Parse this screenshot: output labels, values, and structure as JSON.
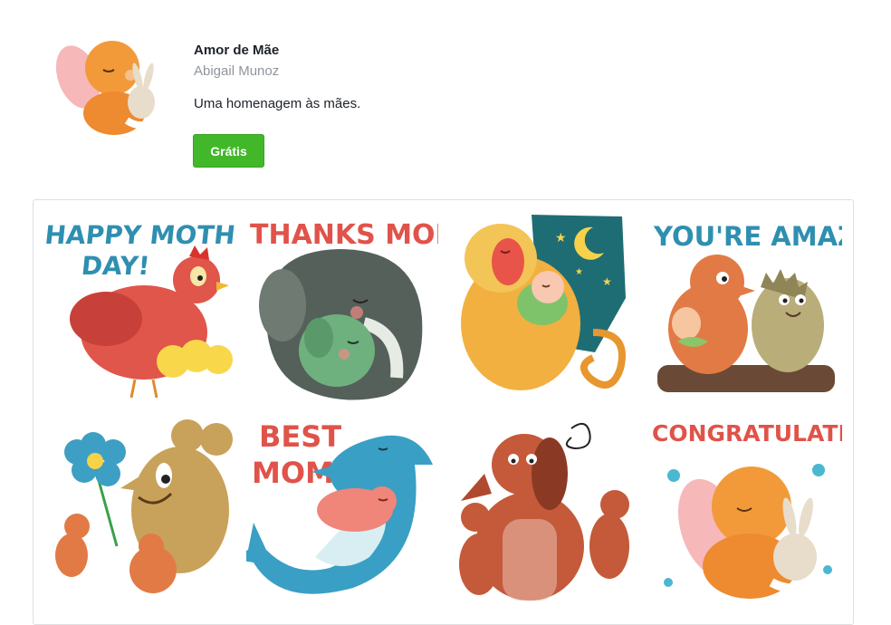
{
  "pack": {
    "title": "Amor de Mãe",
    "author": "Abigail Munoz",
    "description": "Uma homenagem às mães.",
    "price_button": "Grátis",
    "icon": "mother-and-baby-sticker-icon"
  },
  "stickers": [
    {
      "caption": "HAPPY MOTHER'S",
      "caption2": "DAY!",
      "icon": "hen-with-chicks-sticker"
    },
    {
      "caption": "THANKS MOM",
      "icon": "elephant-hug-sticker"
    },
    {
      "caption": "",
      "icon": "monkey-with-baby-sticker"
    },
    {
      "caption": "YOU'RE AMAZING",
      "icon": "bear-and-hedgehog-sticker"
    },
    {
      "caption": "",
      "icon": "mouse-with-flower-sticker"
    },
    {
      "caption": "BEST",
      "caption2": "MOM",
      "icon": "dolphin-mom-sticker"
    },
    {
      "caption": "",
      "icon": "tired-dog-with-puppies-sticker"
    },
    {
      "caption": "CONGRATULATIONS",
      "icon": "mother-hugging-bunny-sticker"
    }
  ],
  "colors": {
    "button": "#42b72a",
    "caption_blue": "#2f8fb0",
    "caption_red": "#e0534a"
  }
}
